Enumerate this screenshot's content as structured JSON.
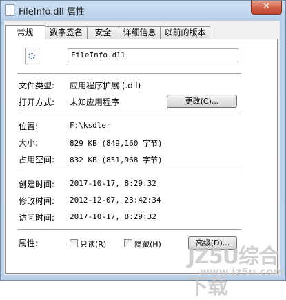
{
  "window": {
    "title": "FileInfo.dll 属性",
    "close_label": "✕"
  },
  "tabs": [
    {
      "label": "常规"
    },
    {
      "label": "数字签名"
    },
    {
      "label": "安全"
    },
    {
      "label": "详细信息"
    },
    {
      "label": "以前的版本"
    }
  ],
  "general": {
    "file_name": "FileInfo.dll",
    "type_label": "文件类型:",
    "type_value": "应用程序扩展 (.dll)",
    "opens_label": "打开方式:",
    "opens_value": "未知应用程序",
    "change_button": "更改(C)...",
    "location_label": "位置:",
    "location_value": "F:\\ksdler",
    "size_label": "大小:",
    "size_value": "829 KB (849,160 字节)",
    "disk_label": "占用空间:",
    "disk_value": "832 KB (851,968 字节)",
    "created_label": "创建时间:",
    "created_value": "2017-10-17, 8:29:32",
    "modified_label": "修改时间:",
    "modified_value": "2012-12-07, 23:42:34",
    "accessed_label": "访问时间:",
    "accessed_value": "2017-10-17, 8:29:32",
    "attributes_label": "属性:",
    "readonly_label": "只读(R)",
    "hidden_label": "隐藏(H)",
    "advanced_button": "高级(D)..."
  },
  "watermark": {
    "main": "JZ5U综合下载",
    "sub": "www.jz5u.com"
  }
}
